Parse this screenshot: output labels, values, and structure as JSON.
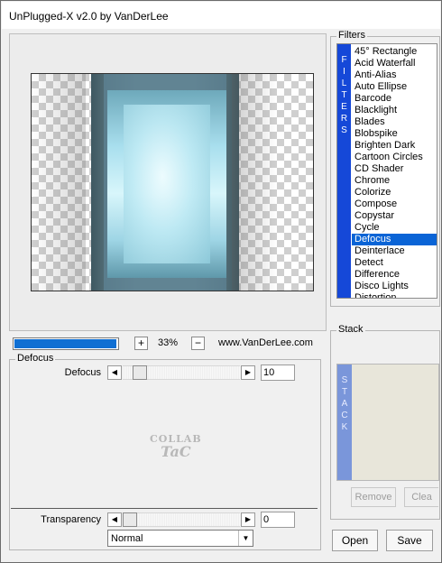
{
  "window": {
    "title": "UnPlugged-X v2.0 by VanDerLee"
  },
  "preview": {
    "zoom_minus": "−",
    "zoom_plus": "+",
    "zoom_value": "33%",
    "credit": "www.VanDerLee.com",
    "progress_fraction": 0.97
  },
  "params": {
    "group_label": "Defocus",
    "defocus": {
      "label": "Defocus",
      "value": "10",
      "fraction": 0.1
    },
    "watermark": {
      "line1": "COLLAB",
      "line2": "TaC"
    }
  },
  "blend": {
    "transparency_label": "Transparency",
    "transparency_value": "0",
    "transparency_fraction": 0.0,
    "mode": "Normal"
  },
  "filters": {
    "group_label": "Filters",
    "strip_text": "FILTERS",
    "items": [
      "45° Rectangle",
      "Acid Waterfall",
      "Anti-Alias",
      "Auto Ellipse",
      "Barcode",
      "Blacklight",
      "Blades",
      "Blobspike",
      "Brighten Dark",
      "Cartoon Circles",
      "CD Shader",
      "Chrome",
      "Colorize",
      "Compose",
      "Copystar",
      "Cycle",
      "Defocus",
      "Deinterlace",
      "Detect",
      "Difference",
      "Disco Lights",
      "Distortion"
    ],
    "selected": "Defocus"
  },
  "stack": {
    "group_label": "Stack",
    "strip_text": "STACK",
    "remove_label": "Remove",
    "clear_label": "Clea"
  },
  "buttons": {
    "open_label": "Open",
    "save_label": "Save"
  },
  "colors": {
    "accent": "#0a64d6",
    "strip": "#1548d8",
    "stack_strip": "#7a96da"
  },
  "icons": {
    "left_arrow": "left-triangle",
    "right_arrow": "right-triangle",
    "dropdown": "down-triangle"
  }
}
